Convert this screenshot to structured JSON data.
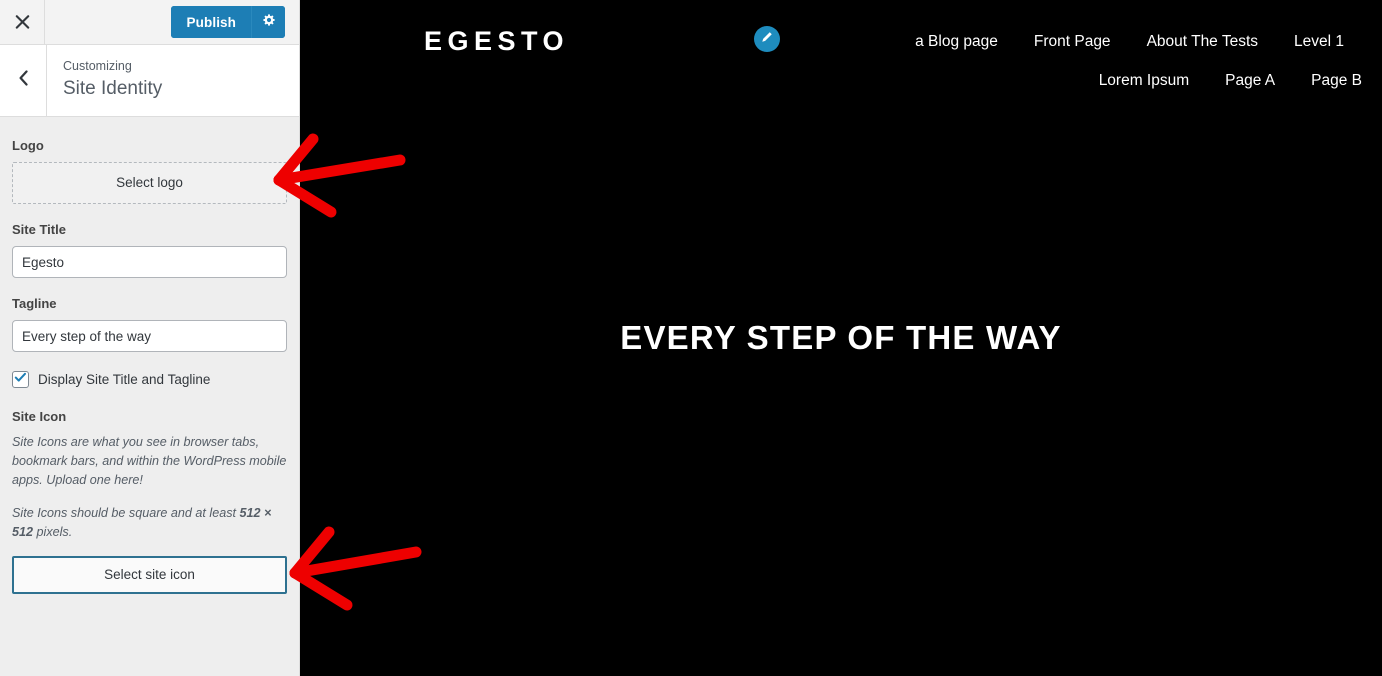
{
  "customizer": {
    "topbar": {
      "close_icon": "close-icon",
      "publish_label": "Publish",
      "gear_icon": "gear-icon"
    },
    "header": {
      "back_icon": "chevron-left-icon",
      "eyebrow": "Customizing",
      "title": "Site Identity"
    },
    "controls": {
      "logo": {
        "label": "Logo",
        "button_label": "Select logo"
      },
      "site_title": {
        "label": "Site Title",
        "value": "Egesto"
      },
      "tagline": {
        "label": "Tagline",
        "value": "Every step of the way"
      },
      "display_title_tagline": {
        "label": "Display Site Title and Tagline",
        "checked": true,
        "check_icon": "checkmark-icon"
      },
      "site_icon": {
        "label": "Site Icon",
        "help_1_a": "Site Icons are what you see in browser tabs, bookmark bars, and within the WordPress mobile apps. Upload one here!",
        "help_2_a": "Site Icons should be square and at least ",
        "help_2_b": "512 × 512",
        "help_2_c": " pixels.",
        "button_label": "Select site icon",
        "focus_border_color": "#2e7190"
      }
    }
  },
  "preview": {
    "brand": "EGESTO",
    "edit_icon": "pencil-icon",
    "nav": [
      {
        "label": "a Blog page"
      },
      {
        "label": "Front Page"
      },
      {
        "label": "About The Tests"
      },
      {
        "label": "Level 1"
      },
      {
        "label": "Lorem Ipsum"
      },
      {
        "label": "Page A"
      },
      {
        "label": "Page B"
      }
    ],
    "hero_title": "EVERY STEP OF THE WAY",
    "background_color": "#000000"
  },
  "annotations": {
    "arrow_color": "#ee0000",
    "arrows": [
      {
        "name": "arrow-to-select-logo"
      },
      {
        "name": "arrow-to-select-site-icon"
      }
    ]
  }
}
